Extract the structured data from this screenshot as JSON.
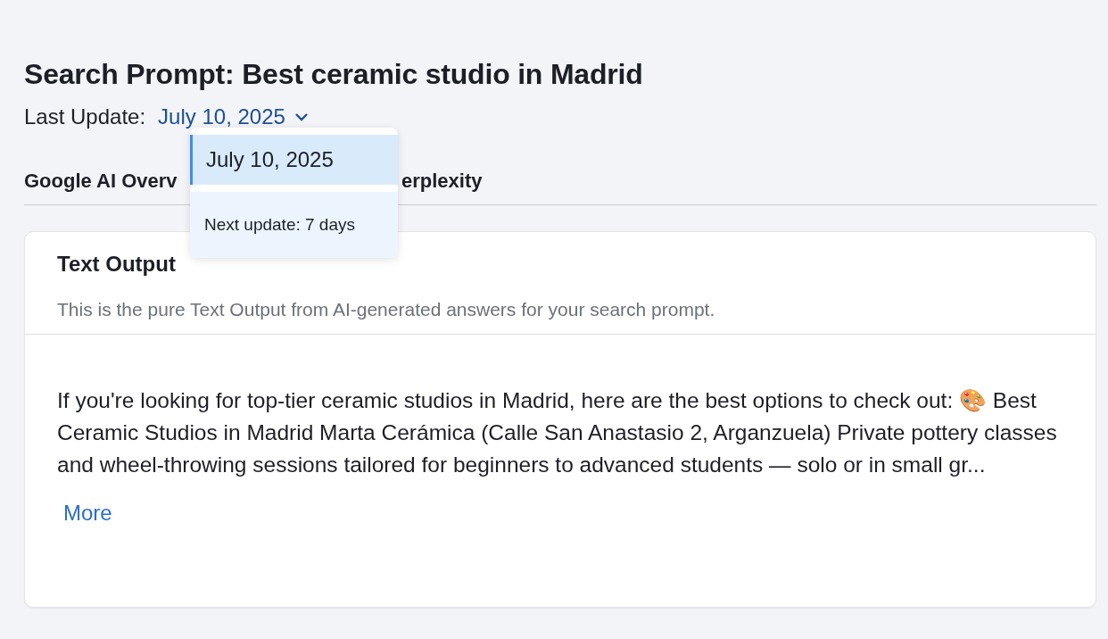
{
  "title": "Search Prompt: Best ceramic studio in Madrid",
  "last_update": {
    "label": "Last Update:",
    "value": "July 10, 2025",
    "expanded": true
  },
  "dropdown": {
    "options": [
      {
        "label": "July 10, 2025",
        "selected": true
      }
    ],
    "footer": "Next update: 7 days"
  },
  "tabs": [
    {
      "label": "Google AI Overv"
    },
    {
      "label": "erplexity"
    }
  ],
  "card": {
    "title": "Text Output",
    "subtitle": "This is the pure Text Output from AI-generated answers for your search prompt.",
    "text": "If you're looking for top-tier ceramic studios in Madrid, here are the best options to check out: 🎨 Best Ceramic Studios in Madrid Marta Cerámica (Calle San Anastasio 2, Arganzuela) Private pottery classes and wheel-throwing sessions tailored for beginners to advanced students — solo or in small gr...",
    "more_link": "More"
  }
}
